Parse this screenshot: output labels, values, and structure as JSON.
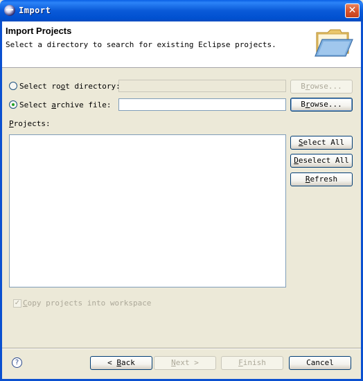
{
  "window": {
    "title": "Import",
    "close_glyph": "✕"
  },
  "header": {
    "title": "Import Projects",
    "description": "Select a directory to search for existing Eclipse projects.",
    "icon": "folder-icon"
  },
  "source": {
    "root_directory": {
      "label_pre": "Select ro",
      "label_mn": "o",
      "label_post": "t directory:",
      "value": "",
      "selected": false,
      "browse": {
        "pre": "B",
        "mn": "r",
        "post": "owse..."
      }
    },
    "archive_file": {
      "label_pre": "Select ",
      "label_mn": "a",
      "label_post": "rchive file:",
      "value": "",
      "selected": true,
      "browse": {
        "pre": "B",
        "mn": "r",
        "post": "owse..."
      }
    }
  },
  "projects": {
    "label_mn": "P",
    "label_post": "rojects:",
    "items": [],
    "select_all": {
      "mn": "S",
      "post": "elect All"
    },
    "deselect_all": {
      "mn": "D",
      "post": "eselect All"
    },
    "refresh": {
      "mn": "R",
      "post": "efresh"
    }
  },
  "copy_into_workspace": {
    "mn": "C",
    "post": "opy projects into workspace",
    "checked": true,
    "check_glyph": "✓"
  },
  "footer": {
    "help_glyph": "?",
    "back": {
      "arrow": "<",
      "mn": "B",
      "post": "ack"
    },
    "next": {
      "mn": "N",
      "post": "ext",
      "arrow": ">"
    },
    "finish": {
      "mn": "F",
      "post": "inish"
    },
    "cancel": "Cancel"
  },
  "colors": {
    "titlebar": "#0a5ad8",
    "dialog_bg": "#ece9d8",
    "accent_border": "#003c74"
  }
}
